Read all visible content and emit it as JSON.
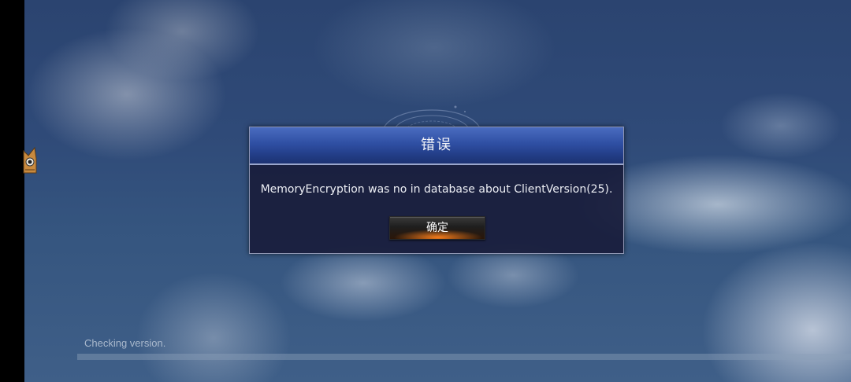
{
  "dialog": {
    "title": "错误",
    "message": "MemoryEncryption was no in database about ClientVersion(25).",
    "confirm_label": "确定"
  },
  "status": {
    "text": "Checking version.",
    "progress": 0
  },
  "colors": {
    "header_blue": "#2f4fa3",
    "dialog_bg": "#181c3a",
    "button_glow": "#ff7d1e",
    "sky": "#2f4a78"
  },
  "icons": {
    "mascot": "cat-mascot-icon",
    "emblem": "magic-circle-emblem"
  }
}
